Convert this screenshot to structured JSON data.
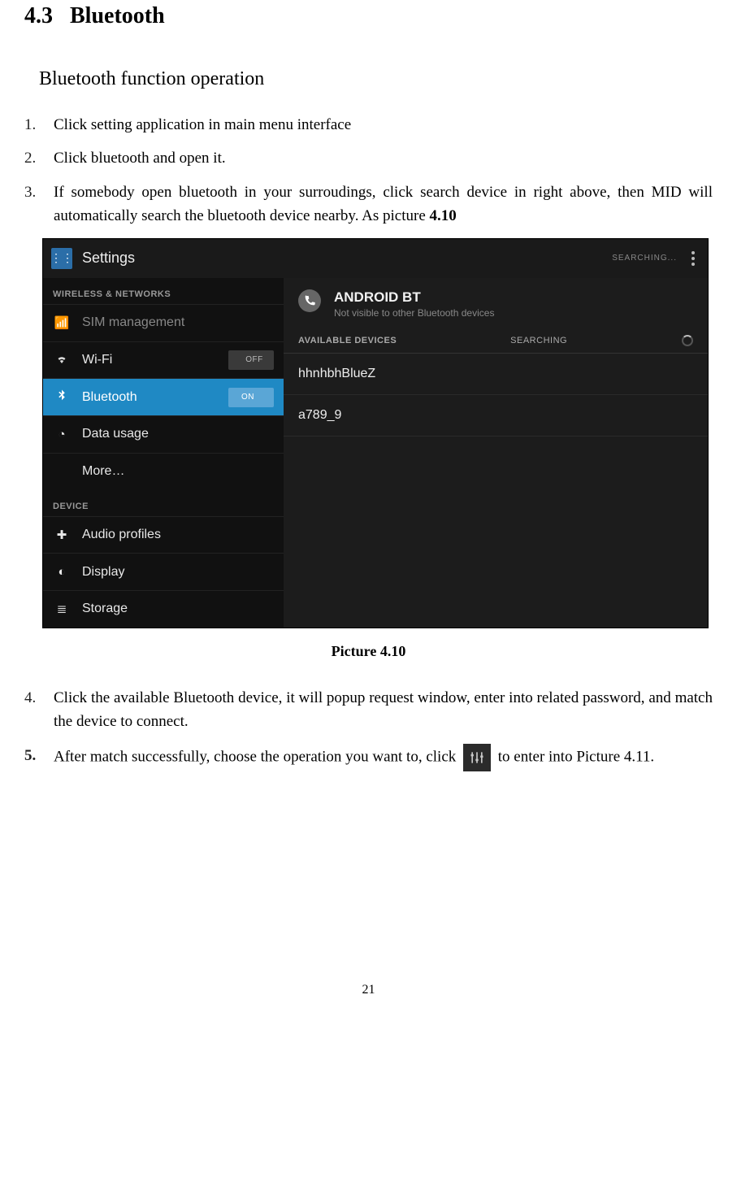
{
  "heading": {
    "number": "4.3",
    "title": "Bluetooth"
  },
  "subheading": "Bluetooth function operation",
  "steps": [
    {
      "n": "1.",
      "text": "Click setting application in main menu interface"
    },
    {
      "n": "2.",
      "text": "Click bluetooth and open it."
    },
    {
      "n": "3.",
      "text_a": "If somebody open bluetooth in your surroudings, click search device in right above, then MID will automatically search the bluetooth device nearby. As picture ",
      "text_b": "4.10"
    },
    {
      "n": "4.",
      "text": "Click the available Bluetooth device, it will popup request window, enter into related password, and match the device to connect."
    },
    {
      "n": "5.",
      "text_a": "After match successfully, choose the operation you want to, click ",
      "text_b": " to enter into Picture 4.11."
    }
  ],
  "screenshot": {
    "titlebar": {
      "title": "Settings",
      "status": "SEARCHING..."
    },
    "sidebar": {
      "cat1": "WIRELESS & NETWORKS",
      "items1": [
        {
          "icon": "📶",
          "label": "SIM management",
          "dim": true
        },
        {
          "icon": "▾",
          "label": "Wi-Fi",
          "toggle": "OFF"
        },
        {
          "icon": "∦",
          "label": "Bluetooth",
          "toggle": "ON",
          "active": true
        },
        {
          "icon": "◔",
          "label": "Data usage"
        },
        {
          "icon": "",
          "label": "More…"
        }
      ],
      "cat2": "DEVICE",
      "items2": [
        {
          "icon": "✚",
          "label": "Audio profiles"
        },
        {
          "icon": "◐",
          "label": "Display"
        },
        {
          "icon": "≣",
          "label": "Storage"
        }
      ]
    },
    "main": {
      "self_name": "ANDROID BT",
      "self_sub": "Not visible to other Bluetooth devices",
      "avail_label": "AVAILABLE DEVICES",
      "searching_label": "SEARCHING",
      "devices": [
        "hhnhbhBlueZ",
        "a789_9"
      ]
    }
  },
  "caption": "Picture 4.10",
  "page_number": "21"
}
